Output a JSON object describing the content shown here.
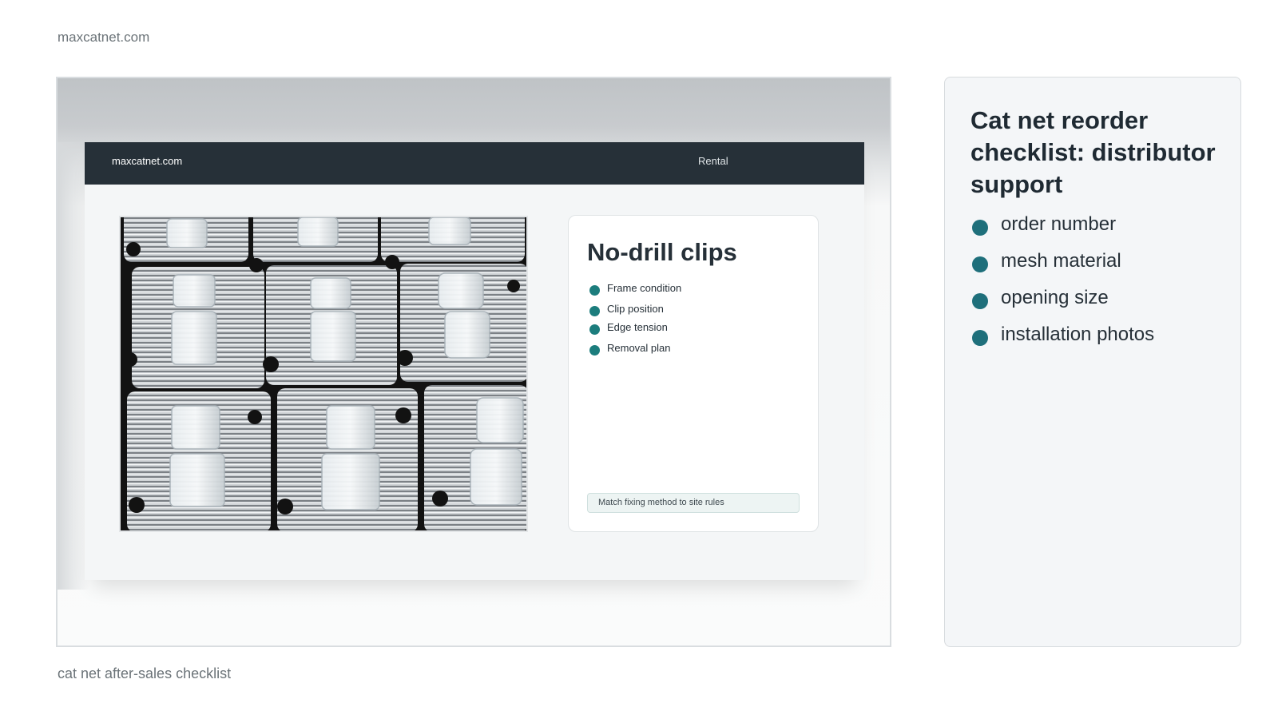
{
  "site": "maxcatnet.com",
  "caption": "cat net after-sales checklist",
  "screen": {
    "brand": "maxcatnet.com",
    "nav_item": "Rental",
    "card": {
      "title": "No-drill clips",
      "items": [
        "Frame condition",
        "Clip position",
        "Edge tension",
        "Removal plan"
      ],
      "note": "Match fixing method to site rules"
    }
  },
  "panel": {
    "title": "Cat net reorder checklist: distributor support",
    "items": [
      "order number",
      "mesh material",
      "opening size",
      "installation photos"
    ]
  },
  "colors": {
    "topbar": "#263038",
    "bullet_card": "#1c7d7d",
    "bullet_panel": "#1e6f7b"
  }
}
